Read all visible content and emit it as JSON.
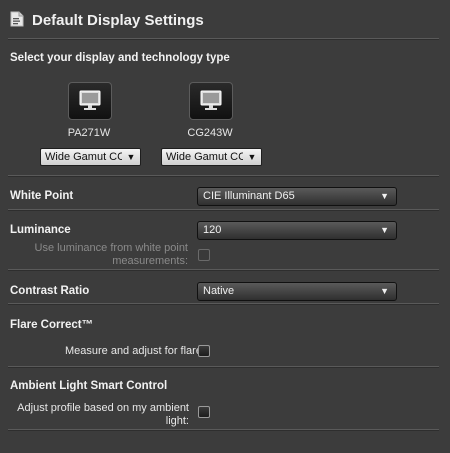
{
  "header": {
    "title": "Default Display Settings",
    "icon": "document-settings-icon"
  },
  "display_section": {
    "heading": "Select your display and technology type",
    "displays": [
      {
        "name": "PA271W",
        "technology": "Wide Gamut CC",
        "icon": "monitor-icon"
      },
      {
        "name": "CG243W",
        "technology": "Wide Gamut CC",
        "icon": "monitor-icon"
      }
    ]
  },
  "white_point": {
    "label": "White Point",
    "value": "CIE Illuminant D65"
  },
  "luminance": {
    "label": "Luminance",
    "value": "120",
    "checkbox_label": "Use luminance from white point measurements:",
    "checkbox_label_line1": "Use luminance from white point",
    "checkbox_label_line2": "measurements:",
    "checked": false,
    "disabled": true
  },
  "contrast_ratio": {
    "label": "Contrast Ratio",
    "value": "Native"
  },
  "flare_correct": {
    "heading": "Flare Correct™",
    "checkbox_label": "Measure and adjust for flare:",
    "checked": false
  },
  "ambient_light": {
    "heading": "Ambient Light Smart Control",
    "checkbox_label_line1": "Adjust profile based on my ambient",
    "checkbox_label_line2": "light:",
    "checked": false
  },
  "colors": {
    "background": "#3c3c3c",
    "separator": "#5a5a5a",
    "text": "#e6e6e6",
    "disabled_text": "#8a8a8a"
  }
}
